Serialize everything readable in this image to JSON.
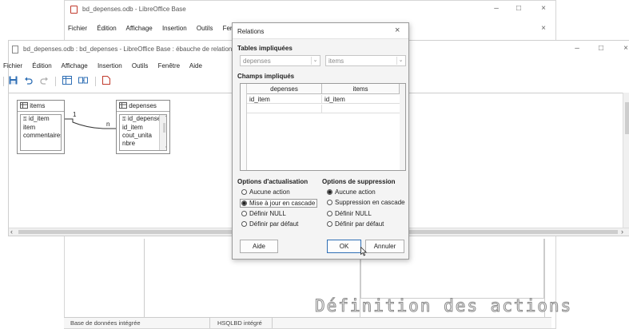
{
  "back_window": {
    "title": "bd_depenses.odb - LibreOffice Base",
    "menu": [
      "Fichier",
      "Édition",
      "Affichage",
      "Insertion",
      "Outils",
      "Fen"
    ]
  },
  "front_window": {
    "title": "bd_depenses.odb : bd_depenses - LibreOffice Base : ébauche de relation",
    "menu": [
      "Fichier",
      "Édition",
      "Affichage",
      "Insertion",
      "Outils",
      "Fenêtre",
      "Aide"
    ]
  },
  "relation_design": {
    "table_items": {
      "name": "items",
      "fields": [
        "id_item",
        "item",
        "commentaires"
      ]
    },
    "table_depenses": {
      "name": "depenses",
      "fields": [
        "id_depense",
        "id_item",
        "cout_unita",
        "nbre"
      ]
    },
    "link": {
      "left_card": "1",
      "right_card": "n"
    }
  },
  "dialog": {
    "title": "Relations",
    "close_glyph": "×",
    "tables_label": "Tables impliquées",
    "table_left": "depenses",
    "table_right": "items",
    "fields_label": "Champs impliqués",
    "col_left": "depenses",
    "col_right": "items",
    "row_left": "id_item",
    "row_right": "id_item",
    "update_label": "Options d'actualisation",
    "update_options": [
      "Aucune action",
      "Mise à jour en cascade",
      "Définir NULL",
      "Définir par défaut"
    ],
    "update_selected": 1,
    "delete_label": "Options de suppression",
    "delete_options": [
      "Aucune action",
      "Suppression en cascade",
      "Définir NULL",
      "Définir par défaut"
    ],
    "delete_selected": 0,
    "help_button": "Aide",
    "ok_button": "OK",
    "cancel_button": "Annuler"
  },
  "status_bar": {
    "left": "Base de données intégrée",
    "right": "HSQLBD intégré"
  },
  "overlay_caption": "Définition des actions",
  "colors": {
    "accent": "#2f6fb5",
    "toolbar_red": "#c0392b"
  }
}
